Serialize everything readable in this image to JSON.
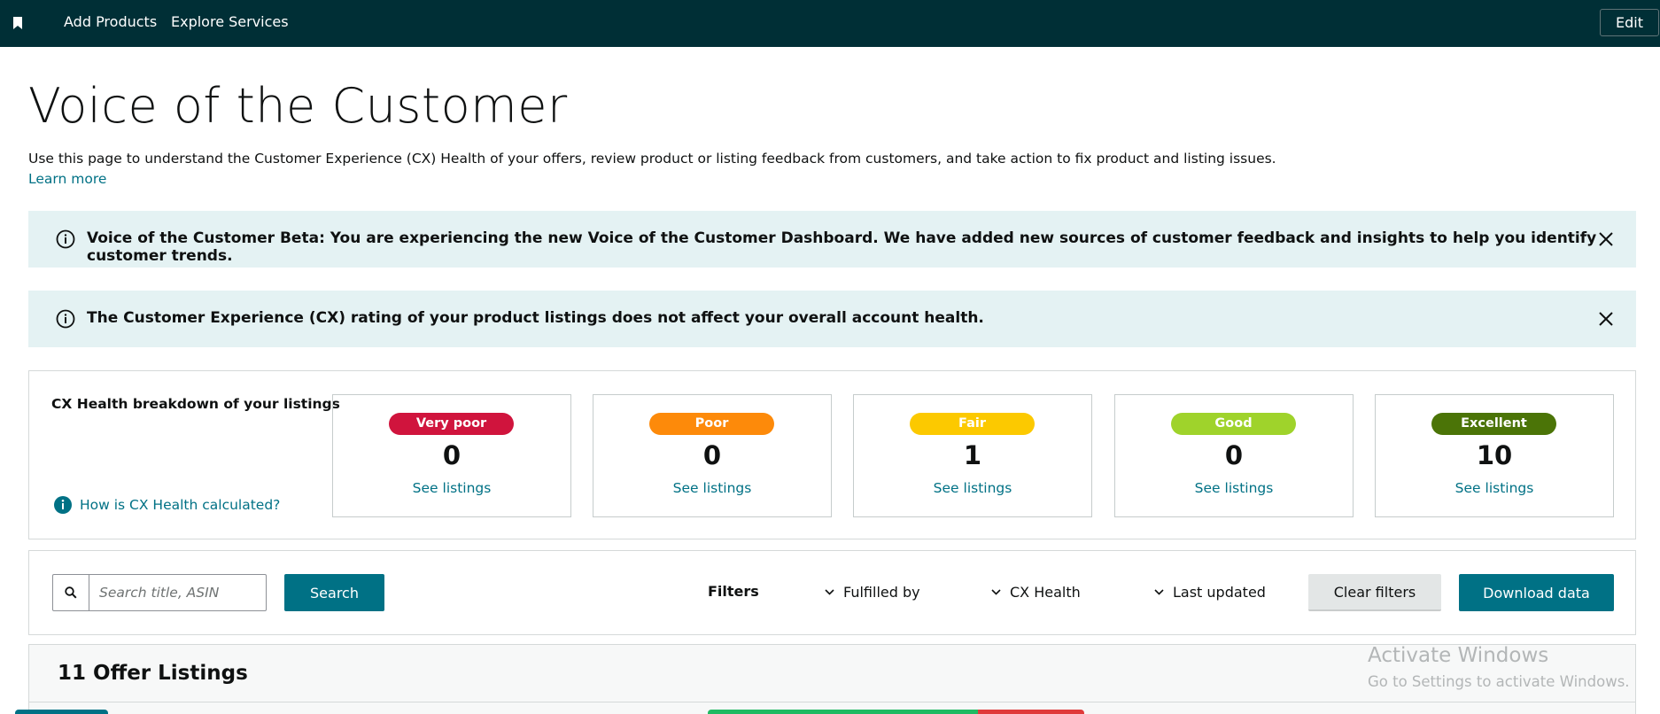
{
  "nav": {
    "links": [
      "Add Products",
      "Explore Services"
    ],
    "edit_label": "Edit"
  },
  "page": {
    "title": "Voice of the Customer",
    "description": "Use this page to understand the Customer Experience (CX) Health of your offers, review product or listing feedback from customers, and take action to fix product and listing issues.",
    "learn_more": "Learn more"
  },
  "alerts": [
    {
      "text": "Voice of the Customer Beta: You are experiencing the new Voice of the Customer Dashboard. We have added new sources of customer feedback and insights to help you identify customer trends."
    },
    {
      "text": "The Customer Experience (CX) rating of your product listings does not affect your overall account health."
    }
  ],
  "cx_health": {
    "title": "CX Health breakdown of your listings",
    "how_link": "How is CX Health calculated?",
    "categories": [
      {
        "label": "Very poor",
        "count": "0",
        "link": "See listings",
        "color": "#d0143d"
      },
      {
        "label": "Poor",
        "count": "0",
        "link": "See listings",
        "color": "#fd8a0a"
      },
      {
        "label": "Fair",
        "count": "1",
        "link": "See listings",
        "color": "#fcc900"
      },
      {
        "label": "Good",
        "count": "0",
        "link": "See listings",
        "color": "#9fd32b"
      },
      {
        "label": "Excellent",
        "count": "10",
        "link": "See listings",
        "color": "#4b7407"
      }
    ]
  },
  "search": {
    "placeholder": "Search title, ASIN",
    "button_label": "Search"
  },
  "filters": {
    "label": "Filters",
    "dropdowns": [
      "Fulfilled by",
      "CX Health",
      "Last updated"
    ],
    "clear_label": "Clear filters",
    "download_label": "Download data"
  },
  "listings": {
    "title": "11 Offer Listings"
  },
  "watermark": {
    "title": "Activate Windows",
    "subtitle": "Go to Settings to activate Windows."
  },
  "colors": {
    "nav_bg": "#002f36",
    "accent": "#007185",
    "alert_bg": "#e4f2f3"
  }
}
